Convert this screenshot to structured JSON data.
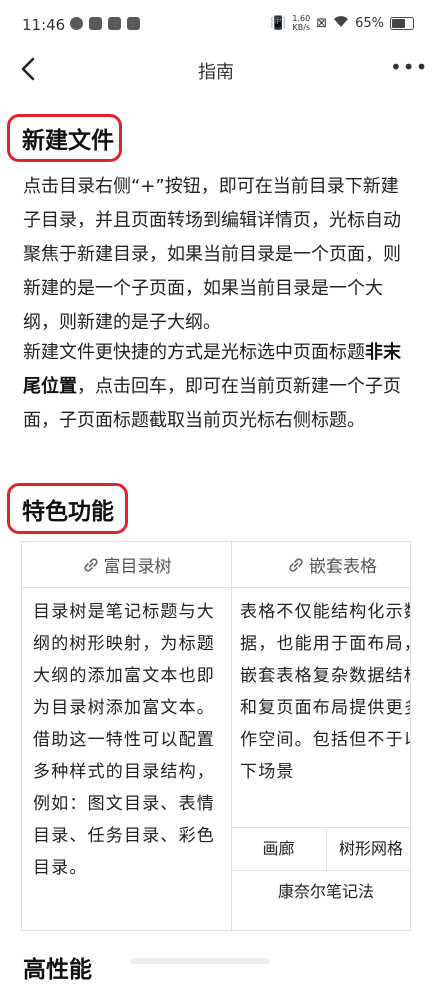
{
  "status_bar": {
    "time": "11:46",
    "net_speed_value": "1.60",
    "net_speed_unit": "KB/s",
    "battery": "65%"
  },
  "header": {
    "title": "指南"
  },
  "sections": {
    "new_file": {
      "heading": "新建文件",
      "para1": "点击目录右侧“+”按钮，即可在当前目录下新建子目录，并且页面转场到编辑详情页，光标自动聚焦于新建目录，如果当前目录是一个页面，则新建的是一个子页面，如果当前目录是一个大纲，则新建的是子大纲。",
      "para2_a": "新建文件更快捷的方式是光标选中页面标题",
      "para2_b": "非末尾位置",
      "para2_c": "，点击回车，即可在当前页新建一个子页面，子页面标题截取当前页光标右侧标题。"
    },
    "features": {
      "heading": "特色功能",
      "table": {
        "col1_header": "富目录树",
        "col1_body": "目录树是笔记标题与大纲的树形映射，为标题大纲的添加富文本也即为目录树添加富文本。借助这一特性可以配置多种样式的目录结构，例如：图文目录、表情目录、任务目录、彩色目录。",
        "col2_header": "嵌套表格",
        "col2_body": "表格不仅能结构化示数据，也能用于面布局，嵌套表格复杂数据结构和复页面布局提供更多作空间。包括但不于以下场景",
        "nested": {
          "cell1": "画廊",
          "cell2": "树形网格",
          "cell3": "康奈尔笔记法"
        }
      }
    },
    "next": {
      "heading_partial": "高性能"
    }
  },
  "colors": {
    "highlight_ring": "#e0242b"
  }
}
